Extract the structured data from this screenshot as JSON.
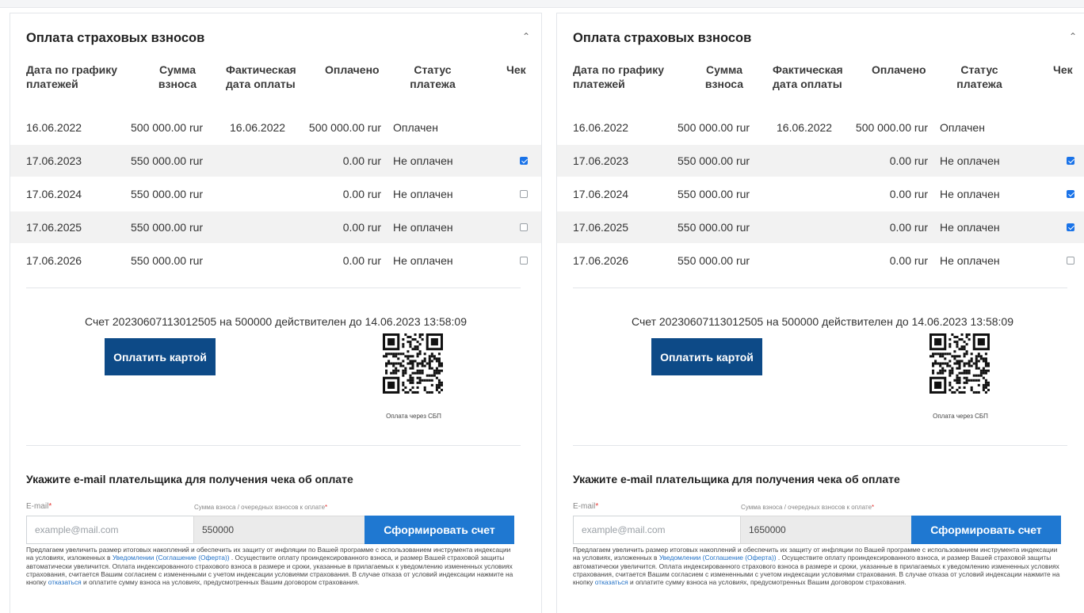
{
  "panels": [
    {
      "title": "Оплата страховых взносов",
      "columns": {
        "date": "Дата по графику\nплатежей",
        "sum": "Сумма\nвзноса",
        "fact": "Фактическая\nдата оплаты",
        "paid": "Оплачено",
        "status": "Статус\nплатежа",
        "check": "Чек"
      },
      "rows": [
        {
          "date": "16.06.2022",
          "sum": "500 000.00 rur",
          "fact": "16.06.2022",
          "paid": "500 000.00 rur",
          "status": "Оплачен",
          "check": null
        },
        {
          "date": "17.06.2023",
          "sum": "550 000.00 rur",
          "fact": "",
          "paid": "0.00 rur",
          "status": "Не оплачен",
          "check": true
        },
        {
          "date": "17.06.2024",
          "sum": "550 000.00 rur",
          "fact": "",
          "paid": "0.00 rur",
          "status": "Не оплачен",
          "check": false
        },
        {
          "date": "17.06.2025",
          "sum": "550 000.00 rur",
          "fact": "",
          "paid": "0.00 rur",
          "status": "Не оплачен",
          "check": false
        },
        {
          "date": "17.06.2026",
          "sum": "550 000.00 rur",
          "fact": "",
          "paid": "0.00 rur",
          "status": "Не оплачен",
          "check": false
        }
      ],
      "invoice": "Счет 20230607113012505 на 500000 действителен до 14.06.2023 13:58:09",
      "pay_button": "Оплатить картой",
      "qr_caption": "Оплата через СБП",
      "email_title": "Укажите e-mail плательщика для получения чека об оплате",
      "email_label": "E-mail",
      "sum_label": "Сумма взноса / очередных взносов к оплате",
      "required_mark": "*",
      "email_placeholder": "example@mail.com",
      "sum_value": "550000",
      "form_button": "Сформировать счет",
      "note_part1": "Предлагаем увеличить размер итоговых накоплений и обеспечить их защиту от инфляции по Вашей программе с использованием инструмента индексации на условиях, изложенных в ",
      "note_link1": "Уведомлении (Соглашение (Оферта))",
      "note_part2": " . Осуществите оплату проиндексированного взноса, и размер Вашей страховой защиты автоматически увеличится. Оплата индексированного страхового взноса в размере и сроки, указанные в прилагаемых к уведомлению измененных условиях страхования, считается Вашим согласием с измененными с учетом индексации условиями страхования. В случае отказа от условий индексации нажмите на кнопку ",
      "note_link2": "отказаться",
      "note_part3": " и оплатите сумму взноса на условиях, предусмотренных Вашим договором страхования."
    },
    {
      "title": "Оплата страховых взносов",
      "columns": {
        "date": "Дата по графику\nплатежей",
        "sum": "Сумма\nвзноса",
        "fact": "Фактическая\nдата оплаты",
        "paid": "Оплачено",
        "status": "Статус\nплатежа",
        "check": "Чек"
      },
      "rows": [
        {
          "date": "16.06.2022",
          "sum": "500 000.00 rur",
          "fact": "16.06.2022",
          "paid": "500 000.00 rur",
          "status": "Оплачен",
          "check": null
        },
        {
          "date": "17.06.2023",
          "sum": "550 000.00 rur",
          "fact": "",
          "paid": "0.00 rur",
          "status": "Не оплачен",
          "check": true
        },
        {
          "date": "17.06.2024",
          "sum": "550 000.00 rur",
          "fact": "",
          "paid": "0.00 rur",
          "status": "Не оплачен",
          "check": true
        },
        {
          "date": "17.06.2025",
          "sum": "550 000.00 rur",
          "fact": "",
          "paid": "0.00 rur",
          "status": "Не оплачен",
          "check": true
        },
        {
          "date": "17.06.2026",
          "sum": "550 000.00 rur",
          "fact": "",
          "paid": "0.00 rur",
          "status": "Не оплачен",
          "check": false
        }
      ],
      "invoice": "Счет 20230607113012505 на 500000 действителен до 14.06.2023 13:58:09",
      "pay_button": "Оплатить картой",
      "qr_caption": "Оплата через СБП",
      "email_title": "Укажите e-mail плательщика для получения чека об оплате",
      "email_label": "E-mail",
      "sum_label": "Сумма взноса / очередных взносов к оплате",
      "required_mark": "*",
      "email_placeholder": "example@mail.com",
      "sum_value": "1650000",
      "form_button": "Сформировать счет",
      "note_part1": "Предлагаем увеличить размер итоговых накоплений и обеспечить их защиту от инфляции по Вашей программе с использованием инструмента индексации на условиях, изложенных в ",
      "note_link1": "Уведомлении (Соглашение (Оферта))",
      "note_part2": " . Осуществите оплату проиндексированного взноса, и размер Вашей страховой защиты автоматически увеличится. Оплата индексированного страхового взноса в размере и сроки, указанные в прилагаемых к уведомлению измененных условиях страхования, считается Вашим согласием с измененными с учетом индексации условиями страхования. В случае отказа от условий индексации нажмите на кнопку ",
      "note_link2": "отказаться",
      "note_part3": " и оплатите сумму взноса на условиях, предусмотренных Вашим договором страхования."
    }
  ],
  "colors": {
    "pay_button": "#0d4a87",
    "form_button": "#1f78d1",
    "link": "#1f6fc5",
    "checkbox_checked": "#1a73e8",
    "row_shade": "#f2f2f2"
  },
  "icons": {
    "collapse": "chevron-up-icon",
    "qr": "qr-code-icon"
  }
}
